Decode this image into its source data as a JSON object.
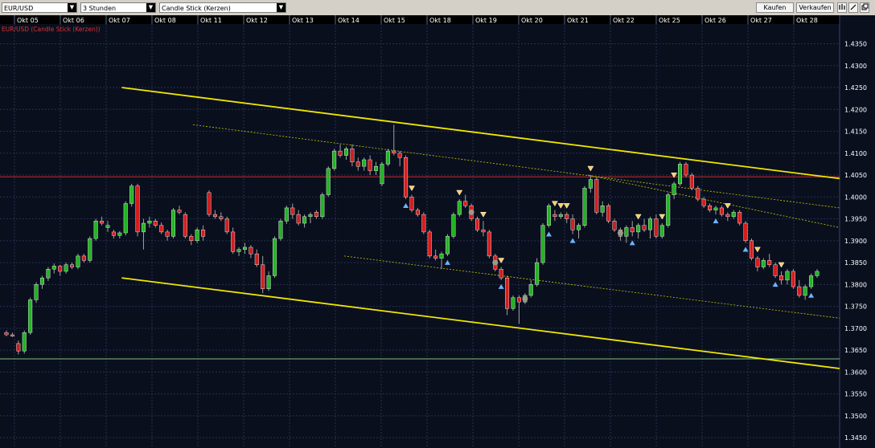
{
  "toolbar": {
    "symbol": "EUR/USD",
    "interval": "3 Stunden",
    "chart_style": "Candle Stick (Kerzen)",
    "buy_label": "Kaufen",
    "sell_label": "Verkaufen",
    "icons": [
      "bar-chart-icon",
      "draw-line-icon",
      "popout-icon"
    ]
  },
  "colors": {
    "background": "#0a0f1e",
    "grid": "#25304e",
    "up_candle": "#22b422",
    "down_candle": "#d21e1e",
    "channel_line": "#f0e800",
    "inner_line": "#c8c800",
    "red_hline": "#c82828",
    "green_hline": "#7fbf7f",
    "legend_text": "#e03030",
    "axis_text": "#ffffff"
  },
  "chart_data": {
    "type": "candlestick",
    "title": "EUR/USD (Candle Stick (Kerzen))",
    "x_tick_labels": [
      "Okt 05",
      "Okt 06",
      "Okt 07",
      "Okt 08",
      "Okt 11",
      "Okt 12",
      "Okt 13",
      "Okt 14",
      "Okt 15",
      "Okt 18",
      "Okt 19",
      "Okt 20",
      "Okt 21",
      "Okt 22",
      "Okt 25",
      "Okt 26",
      "Okt 27",
      "Okt 28"
    ],
    "y_tick_labels": [
      "1.3450",
      "1.3500",
      "1.3550",
      "1.3600",
      "1.3650",
      "1.3700",
      "1.3750",
      "1.3800",
      "1.3850",
      "1.3900",
      "1.3950",
      "1.4000",
      "1.4050",
      "1.4100",
      "1.4150",
      "1.4200",
      "1.4250",
      "1.4300",
      "1.4350"
    ],
    "ylim": [
      1.343,
      1.4395
    ],
    "grid": true,
    "candles_ohlc": [
      [
        1.369,
        1.3695,
        1.3682,
        1.3685
      ],
      [
        1.3685,
        1.369,
        1.368,
        1.3682
      ],
      [
        1.3665,
        1.3672,
        1.364,
        1.3648
      ],
      [
        1.3648,
        1.3695,
        1.3642,
        1.369
      ],
      [
        1.369,
        1.377,
        1.3685,
        1.3765
      ],
      [
        1.3765,
        1.3805,
        1.3758,
        1.38
      ],
      [
        1.38,
        1.382,
        1.379,
        1.3815
      ],
      [
        1.3815,
        1.384,
        1.3808,
        1.3835
      ],
      [
        1.3835,
        1.3848,
        1.3825,
        1.3842
      ],
      [
        1.3842,
        1.3845,
        1.382,
        1.383
      ],
      [
        1.383,
        1.385,
        1.3825,
        1.3845
      ],
      [
        1.3845,
        1.385,
        1.3835,
        1.384
      ],
      [
        1.384,
        1.387,
        1.3835,
        1.3865
      ],
      [
        1.3865,
        1.387,
        1.385,
        1.3855
      ],
      [
        1.3855,
        1.391,
        1.385,
        1.3905
      ],
      [
        1.3905,
        1.395,
        1.39,
        1.3945
      ],
      [
        1.3945,
        1.3955,
        1.3935,
        1.394
      ],
      [
        1.393,
        1.3945,
        1.392,
        1.3935
      ],
      [
        1.392,
        1.3925,
        1.3905,
        1.3912
      ],
      [
        1.3912,
        1.3922,
        1.3905,
        1.3918
      ],
      [
        1.3918,
        1.399,
        1.3912,
        1.3985
      ],
      [
        1.3985,
        1.403,
        1.3978,
        1.4025
      ],
      [
        1.4025,
        1.403,
        1.391,
        1.392
      ],
      [
        1.392,
        1.395,
        1.388,
        1.394
      ],
      [
        1.394,
        1.3955,
        1.393,
        1.3945
      ],
      [
        1.3945,
        1.395,
        1.393,
        1.3935
      ],
      [
        1.3935,
        1.3942,
        1.3915,
        1.392
      ],
      [
        1.392,
        1.3925,
        1.39,
        1.391
      ],
      [
        1.391,
        1.3975,
        1.3905,
        1.397
      ],
      [
        1.397,
        1.398,
        1.396,
        1.3965
      ],
      [
        1.396,
        1.3965,
        1.3905,
        1.391
      ],
      [
        1.391,
        1.3915,
        1.389,
        1.39
      ],
      [
        1.39,
        1.393,
        1.3895,
        1.3925
      ],
      [
        1.3925,
        1.3935,
        1.39,
        1.391
      ],
      [
        1.401,
        1.4015,
        1.3955,
        1.396
      ],
      [
        1.396,
        1.397,
        1.395,
        1.3955
      ],
      [
        1.3955,
        1.3965,
        1.3945,
        1.395
      ],
      [
        1.395,
        1.3955,
        1.3915,
        1.392
      ],
      [
        1.392,
        1.393,
        1.387,
        1.3875
      ],
      [
        1.3875,
        1.3885,
        1.3865,
        1.388
      ],
      [
        1.388,
        1.3895,
        1.387,
        1.3885
      ],
      [
        1.3885,
        1.389,
        1.386,
        1.387
      ],
      [
        1.387,
        1.388,
        1.384,
        1.3845
      ],
      [
        1.3845,
        1.3865,
        1.378,
        1.379
      ],
      [
        1.379,
        1.383,
        1.3785,
        1.382
      ],
      [
        1.382,
        1.391,
        1.3815,
        1.3905
      ],
      [
        1.3905,
        1.395,
        1.39,
        1.3945
      ],
      [
        1.3945,
        1.398,
        1.3938,
        1.3975
      ],
      [
        1.3975,
        1.3985,
        1.395,
        1.396
      ],
      [
        1.396,
        1.397,
        1.3935,
        1.394
      ],
      [
        1.394,
        1.396,
        1.393,
        1.3955
      ],
      [
        1.3955,
        1.3965,
        1.394,
        1.396
      ],
      [
        1.3965,
        1.397,
        1.395,
        1.3955
      ],
      [
        1.3955,
        1.401,
        1.395,
        1.4005
      ],
      [
        1.4005,
        1.407,
        1.4,
        1.4065
      ],
      [
        1.4065,
        1.411,
        1.406,
        1.4105
      ],
      [
        1.4105,
        1.412,
        1.409,
        1.4095
      ],
      [
        1.4095,
        1.4115,
        1.4085,
        1.411
      ],
      [
        1.411,
        1.412,
        1.407,
        1.408
      ],
      [
        1.408,
        1.409,
        1.406,
        1.407
      ],
      [
        1.407,
        1.409,
        1.406,
        1.4085
      ],
      [
        1.4085,
        1.4095,
        1.405,
        1.406
      ],
      [
        1.406,
        1.408,
        1.405,
        1.407
      ],
      [
        1.403,
        1.408,
        1.4025,
        1.4075
      ],
      [
        1.4075,
        1.411,
        1.407,
        1.4105
      ],
      [
        1.4105,
        1.4165,
        1.4095,
        1.41
      ],
      [
        1.41,
        1.4105,
        1.407,
        1.409
      ],
      [
        1.409,
        1.4095,
        1.3995,
        1.4
      ],
      [
        1.4,
        1.4005,
        1.3965,
        1.397
      ],
      [
        1.397,
        1.3975,
        1.3955,
        1.396
      ],
      [
        1.396,
        1.3965,
        1.3915,
        1.392
      ],
      [
        1.392,
        1.3925,
        1.386,
        1.3865
      ],
      [
        1.3865,
        1.388,
        1.3855,
        1.386
      ],
      [
        1.386,
        1.3875,
        1.3835,
        1.387
      ],
      [
        1.387,
        1.3915,
        1.3865,
        1.391
      ],
      [
        1.391,
        1.3965,
        1.3905,
        1.396
      ],
      [
        1.396,
        1.3995,
        1.3955,
        1.399
      ],
      [
        1.399,
        1.4005,
        1.3975,
        1.398
      ],
      [
        1.398,
        1.3985,
        1.3945,
        1.395
      ],
      [
        1.395,
        1.3955,
        1.392,
        1.3925
      ],
      [
        1.3925,
        1.3945,
        1.391,
        1.392
      ],
      [
        1.392,
        1.3925,
        1.386,
        1.3865
      ],
      [
        1.3865,
        1.387,
        1.383,
        1.3835
      ],
      [
        1.3835,
        1.384,
        1.381,
        1.3815
      ],
      [
        1.3815,
        1.382,
        1.373,
        1.3745
      ],
      [
        1.3745,
        1.3775,
        1.374,
        1.377
      ],
      [
        1.377,
        1.3775,
        1.371,
        1.376
      ],
      [
        1.376,
        1.378,
        1.3755,
        1.3775
      ],
      [
        1.3775,
        1.381,
        1.377,
        1.38
      ],
      [
        1.38,
        1.386,
        1.3795,
        1.385
      ],
      [
        1.385,
        1.394,
        1.3845,
        1.3935
      ],
      [
        1.3935,
        1.3985,
        1.393,
        1.398
      ],
      [
        1.396,
        1.397,
        1.3945,
        1.3955
      ],
      [
        1.3955,
        1.3965,
        1.395,
        1.396
      ],
      [
        1.396,
        1.3965,
        1.394,
        1.395
      ],
      [
        1.395,
        1.396,
        1.3915,
        1.3925
      ],
      [
        1.3925,
        1.394,
        1.3905,
        1.3935
      ],
      [
        1.3935,
        1.4025,
        1.393,
        1.402
      ],
      [
        1.402,
        1.405,
        1.401,
        1.404
      ],
      [
        1.404,
        1.4045,
        1.396,
        1.3965
      ],
      [
        1.3965,
        1.399,
        1.3955,
        1.398
      ],
      [
        1.398,
        1.3985,
        1.394,
        1.3945
      ],
      [
        1.3945,
        1.395,
        1.392,
        1.3925
      ],
      [
        1.3925,
        1.393,
        1.39,
        1.391
      ],
      [
        1.391,
        1.3935,
        1.3895,
        1.393
      ],
      [
        1.393,
        1.3945,
        1.391,
        1.392
      ],
      [
        1.392,
        1.394,
        1.3905,
        1.3935
      ],
      [
        1.3935,
        1.395,
        1.392,
        1.3925
      ],
      [
        1.3925,
        1.3955,
        1.3905,
        1.395
      ],
      [
        1.395,
        1.396,
        1.3905,
        1.391
      ],
      [
        1.391,
        1.394,
        1.3905,
        1.3935
      ],
      [
        1.3935,
        1.401,
        1.393,
        1.4005
      ],
      [
        1.4005,
        1.4035,
        1.3995,
        1.403
      ],
      [
        1.403,
        1.408,
        1.4025,
        1.4075
      ],
      [
        1.4075,
        1.408,
        1.4045,
        1.405
      ],
      [
        1.405,
        1.4055,
        1.4015,
        1.402
      ],
      [
        1.402,
        1.4025,
        1.399,
        1.3995
      ],
      [
        1.3995,
        1.4,
        1.3975,
        1.398
      ],
      [
        1.398,
        1.3985,
        1.3965,
        1.397
      ],
      [
        1.397,
        1.398,
        1.396,
        1.3975
      ],
      [
        1.3975,
        1.398,
        1.3955,
        1.396
      ],
      [
        1.396,
        1.3965,
        1.3945,
        1.3955
      ],
      [
        1.3955,
        1.397,
        1.395,
        1.3965
      ],
      [
        1.3965,
        1.397,
        1.3935,
        1.394
      ],
      [
        1.394,
        1.3945,
        1.3895,
        1.39
      ],
      [
        1.39,
        1.3905,
        1.3855,
        1.386
      ],
      [
        1.386,
        1.3865,
        1.383,
        1.384
      ],
      [
        1.384,
        1.386,
        1.3835,
        1.3855
      ],
      [
        1.3855,
        1.387,
        1.384,
        1.3845
      ],
      [
        1.3845,
        1.385,
        1.3815,
        1.382
      ],
      [
        1.382,
        1.383,
        1.38,
        1.381
      ],
      [
        1.381,
        1.3835,
        1.38,
        1.383
      ],
      [
        1.383,
        1.3835,
        1.379,
        1.3795
      ],
      [
        1.3795,
        1.381,
        1.377,
        1.3775
      ],
      [
        1.3775,
        1.38,
        1.3765,
        1.3795
      ],
      [
        1.3795,
        1.3825,
        1.379,
        1.382
      ],
      [
        1.382,
        1.3835,
        1.3815,
        1.383
      ]
    ],
    "channel_lines": [
      {
        "name": "upper-channel",
        "kind": "main",
        "from": [
          0.145,
          1.425
        ],
        "to": [
          1.0,
          1.4042
        ]
      },
      {
        "name": "lower-channel",
        "kind": "main",
        "from": [
          0.145,
          1.3815
        ],
        "to": [
          1.0,
          1.3608
        ]
      },
      {
        "name": "inner-upper-1",
        "kind": "inner",
        "from": [
          0.23,
          1.4165
        ],
        "to": [
          1.0,
          1.3975
        ]
      },
      {
        "name": "inner-upper-2",
        "kind": "inner",
        "from": [
          0.7,
          1.405
        ],
        "to": [
          1.0,
          1.393
        ]
      },
      {
        "name": "inner-lower",
        "kind": "inner",
        "from": [
          0.41,
          1.3865
        ],
        "to": [
          1.0,
          1.3723
        ]
      }
    ],
    "horizontal_lines": [
      {
        "name": "red-level",
        "value": 1.4046,
        "color": "red"
      },
      {
        "name": "green-level",
        "value": 1.363,
        "color": "green"
      }
    ],
    "signals": [
      {
        "type": "up",
        "i": 67
      },
      {
        "type": "down",
        "i": 68
      },
      {
        "type": "up",
        "i": 74
      },
      {
        "type": "down",
        "i": 76
      },
      {
        "type": "circle",
        "i": 78
      },
      {
        "type": "down",
        "i": 80
      },
      {
        "type": "circle",
        "i": 82
      },
      {
        "type": "down",
        "i": 83
      },
      {
        "type": "up",
        "i": 83
      },
      {
        "type": "circle",
        "i": 87
      },
      {
        "type": "down",
        "i": 92
      },
      {
        "type": "down",
        "i": 93
      },
      {
        "type": "down",
        "i": 94
      },
      {
        "type": "up",
        "i": 91
      },
      {
        "type": "up",
        "i": 95
      },
      {
        "type": "down",
        "i": 98
      },
      {
        "type": "circle",
        "i": 103
      },
      {
        "type": "up",
        "i": 105
      },
      {
        "type": "down",
        "i": 106
      },
      {
        "type": "down",
        "i": 110
      },
      {
        "type": "down",
        "i": 112
      },
      {
        "type": "up",
        "i": 119
      },
      {
        "type": "down",
        "i": 121
      },
      {
        "type": "down",
        "i": 126
      },
      {
        "type": "up",
        "i": 124
      },
      {
        "type": "down",
        "i": 130
      },
      {
        "type": "up",
        "i": 129
      },
      {
        "type": "up",
        "i": 135
      },
      {
        "type": "down",
        "i": 138
      }
    ]
  }
}
